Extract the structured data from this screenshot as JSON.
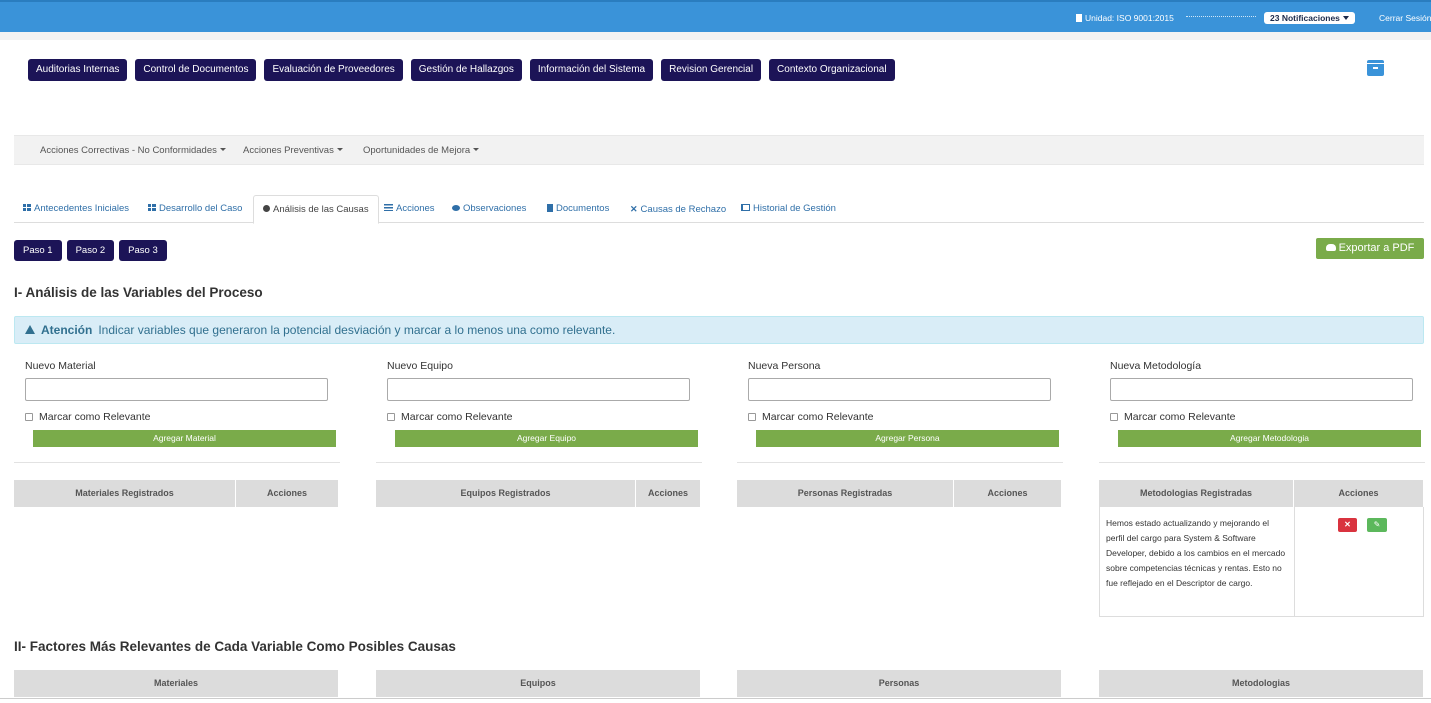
{
  "topbar": {
    "unit": "Unidad: ISO 9001:2015",
    "notifications": "23 Notificaciones",
    "logout": "Cerrar Sesión",
    "color": "#3a93d9"
  },
  "main_nav": [
    "Auditorias Internas",
    "Control de Documentos",
    "Evaluación de Proveedores",
    "Gestión de Hallazgos",
    "Información del Sistema",
    "Revision Gerencial",
    "Contexto Organizacional"
  ],
  "submenu": {
    "correctivas": "Acciones Correctivas - No Conformidades",
    "preventivas": "Acciones Preventivas",
    "mejora": "Oportunidades de Mejora"
  },
  "tabs": {
    "antecedentes": "Antecedentes Iniciales",
    "desarrollo": "Desarrollo del Caso",
    "analisis": "Análisis de las Causas",
    "acciones": "Acciones",
    "observaciones": "Observaciones",
    "documentos": "Documentos",
    "rechazo": "Causas de Rechazo",
    "historial": "Historial de Gestión"
  },
  "pasos": [
    "Paso 1",
    "Paso 2",
    "Paso 3"
  ],
  "export_label": "Exportar a PDF",
  "section1_title": "I- Análisis de las Variables del Proceso",
  "alert": {
    "title": "Atención",
    "text": "Indicar variables que generaron la potencial desviación y marcar a lo menos una como relevante."
  },
  "columns": {
    "material": {
      "label": "Nuevo Material",
      "checkbox": "Marcar como Relevante",
      "button": "Agregar Material",
      "th_registered": "Materiales Registrados",
      "th_actions": "Acciones"
    },
    "equipo": {
      "label": "Nuevo Equipo",
      "checkbox": "Marcar como Relevante",
      "button": "Agregar Equipo",
      "th_registered": "Equipos Registrados",
      "th_actions": "Acciones"
    },
    "persona": {
      "label": "Nueva Persona",
      "checkbox": "Marcar como Relevante",
      "button": "Agregar Persona",
      "th_registered": "Personas Registradas",
      "th_actions": "Acciones"
    },
    "metodologia": {
      "label": "Nueva Metodología",
      "checkbox": "Marcar como Relevante",
      "button": "Agregar Metodologia",
      "th_registered": "Metodologias Registradas",
      "th_actions": "Acciones",
      "rows": [
        "Hemos estado actualizando y mejorando el perfil del cargo para System & Software Developer, debido a los cambios en el mercado sobre competencias técnicas y rentas. Esto no fue reflejado en el Descriptor de cargo."
      ]
    }
  },
  "section2_title": "II- Factores Más Relevantes de Cada Variable Como Posibles Causas",
  "factors": [
    "Materiales",
    "Equipos",
    "Personas",
    "Metodologias"
  ],
  "colors": {
    "nav_button": "#1c1457",
    "success": "#7aab4a",
    "danger": "#d9333f",
    "alert_bg": "#d9edf7"
  }
}
